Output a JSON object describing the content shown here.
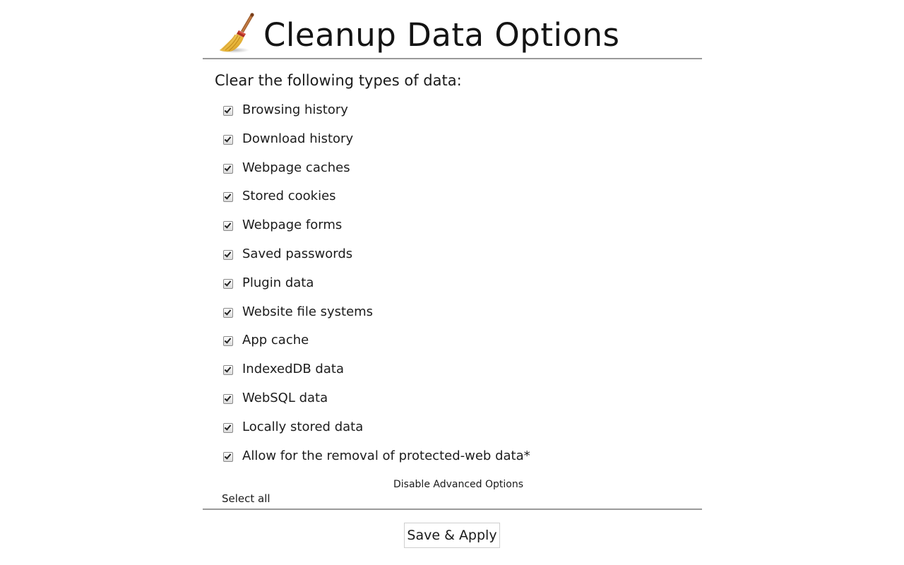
{
  "header": {
    "icon": "broom-icon",
    "title": "Cleanup Data Options"
  },
  "section": {
    "heading": "Clear the following types of data:"
  },
  "options": [
    {
      "label": "Browsing history",
      "checked": true
    },
    {
      "label": "Download history",
      "checked": true
    },
    {
      "label": "Webpage caches",
      "checked": true
    },
    {
      "label": "Stored cookies",
      "checked": true
    },
    {
      "label": "Webpage forms",
      "checked": true
    },
    {
      "label": "Saved passwords",
      "checked": true
    },
    {
      "label": "Plugin data",
      "checked": true
    },
    {
      "label": "Website file systems",
      "checked": true
    },
    {
      "label": "App cache",
      "checked": true
    },
    {
      "label": "IndexedDB data",
      "checked": true
    },
    {
      "label": "WebSQL data",
      "checked": true
    },
    {
      "label": "Locally stored data",
      "checked": true
    },
    {
      "label": "Allow for the removal of protected-web data*",
      "checked": true
    }
  ],
  "links": {
    "advanced": "Disable Advanced Options",
    "select_all": "Select all"
  },
  "footer": {
    "save_label": "Save & Apply"
  }
}
